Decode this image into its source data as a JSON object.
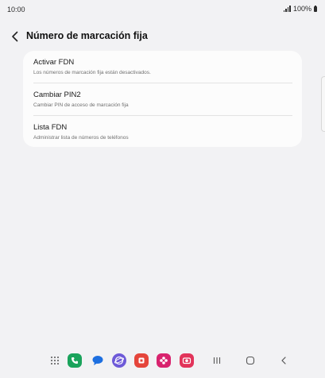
{
  "status_bar": {
    "time": "10:00",
    "battery": "100%",
    "icons": [
      "signal-icon",
      "battery-icon"
    ]
  },
  "header": {
    "back_icon": "chevron-left-icon",
    "title": "Número de marcación fija"
  },
  "settings": {
    "items": [
      {
        "title": "Activar FDN",
        "subtitle": "Los números de marcación fija están desactivados."
      },
      {
        "title": "Cambiar PIN2",
        "subtitle": "Cambiar PIN de acceso de marcación fija"
      },
      {
        "title": "Lista FDN",
        "subtitle": "Administrar lista de números de teléfonos"
      }
    ]
  },
  "bottom_nav": {
    "dock_apps": [
      {
        "name": "apps-grid-icon"
      },
      {
        "name": "phone-app-icon",
        "color": "#1aa35b"
      },
      {
        "name": "messages-app-icon",
        "color": "#1d6fe0"
      },
      {
        "name": "internet-app-icon",
        "color": "#6e5ad8"
      },
      {
        "name": "store-app-icon",
        "color": "#e5453b"
      },
      {
        "name": "gallery-app-icon",
        "color": "#d8236e"
      },
      {
        "name": "camera-app-icon",
        "color": "#e2345a"
      }
    ],
    "system_buttons": [
      "recents-icon",
      "home-icon",
      "back-icon"
    ]
  }
}
